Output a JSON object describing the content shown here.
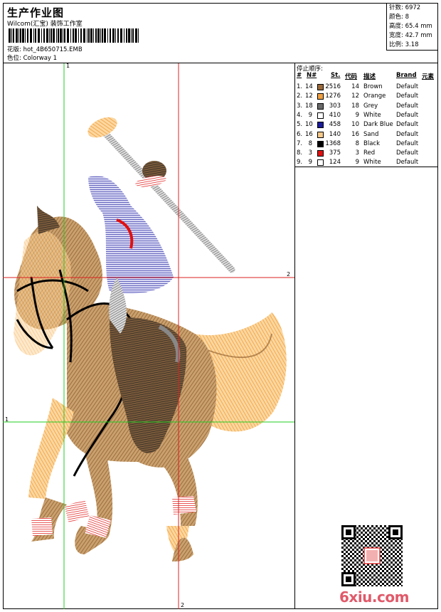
{
  "header": {
    "title": "生产作业图",
    "company": "Wilcom(汇宝) 装饰工作室",
    "design_label": "花版:",
    "design_value": "hot_4B650715.EMB",
    "colorway_label": "色位:",
    "colorway_value": "Colorway 1"
  },
  "stats": [
    {
      "label": "针数:",
      "value": "6972"
    },
    {
      "label": "颜色:",
      "value": "8"
    },
    {
      "label": "高度:",
      "value": "65.4 mm"
    },
    {
      "label": "宽度:",
      "value": "42.7 mm"
    },
    {
      "label": "比例:",
      "value": "3.18"
    }
  ],
  "stop_sequence": {
    "title": "停止顺序:",
    "headers": [
      "#",
      "N#",
      "St.",
      "代码",
      "描述",
      "Brand",
      "元素"
    ],
    "rows": [
      {
        "idx": "1.",
        "n": "14",
        "st": "2516",
        "code": "14",
        "desc": "Brown",
        "brand": "Default",
        "color": "#9b6a3a"
      },
      {
        "idx": "2.",
        "n": "12",
        "st": "1276",
        "code": "12",
        "desc": "Orange",
        "brand": "Default",
        "color": "#f0a040"
      },
      {
        "idx": "3.",
        "n": "18",
        "st": "303",
        "code": "18",
        "desc": "Grey",
        "brand": "Default",
        "color": "#6b6b6b"
      },
      {
        "idx": "4.",
        "n": "9",
        "st": "410",
        "code": "9",
        "desc": "White",
        "brand": "Default",
        "color": "#ffffff"
      },
      {
        "idx": "5.",
        "n": "10",
        "st": "458",
        "code": "10",
        "desc": "Dark Blue",
        "brand": "Default",
        "color": "#1a1a9a"
      },
      {
        "idx": "6.",
        "n": "16",
        "st": "140",
        "code": "16",
        "desc": "Sand",
        "brand": "Default",
        "color": "#f7c98a"
      },
      {
        "idx": "7.",
        "n": "8",
        "st": "1368",
        "code": "8",
        "desc": "Black",
        "brand": "Default",
        "color": "#000000"
      },
      {
        "idx": "8.",
        "n": "3",
        "st": "375",
        "code": "3",
        "desc": "Red",
        "brand": "Default",
        "color": "#e01010"
      },
      {
        "idx": "9.",
        "n": "9",
        "st": "124",
        "code": "9",
        "desc": "White",
        "brand": "Default",
        "color": "#ffffff"
      }
    ]
  },
  "guides": {
    "v1_top": "1",
    "v2_bottom": "2",
    "h2_right": "2",
    "h1_left": "1"
  },
  "watermark": "6xiu.com",
  "colors": {
    "guide_green": "#22cc22",
    "guide_red": "#dd2020"
  }
}
